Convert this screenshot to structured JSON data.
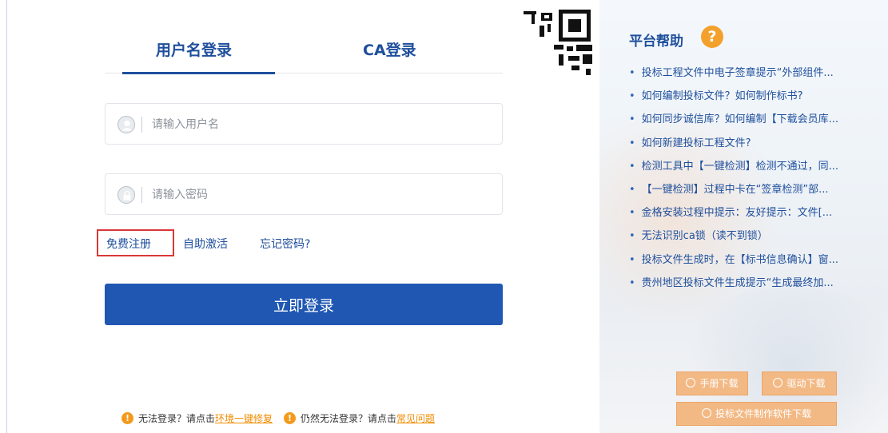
{
  "login": {
    "tabs": [
      {
        "label": "用户名登录",
        "active": true
      },
      {
        "label": "CA登录",
        "active": false
      }
    ],
    "username_placeholder": "请输入用户名",
    "password_placeholder": "请输入密码",
    "links": {
      "register": "免费注册",
      "activate": "自助激活",
      "forgot": "忘记密码?"
    },
    "submit_label": "立即登录",
    "bottom": {
      "warn_icon": "!",
      "text1": "无法登录？请点击",
      "link1": "环境一键修复",
      "text2": "仍然无法登录？请点击",
      "link2": "常见问题"
    }
  },
  "help": {
    "title": "平台帮助",
    "question_icon": "?",
    "items": [
      "投标工程文件中电子签章提示“外部组件...",
      "如何编制投标文件？如何制作标书?",
      "如何同步诚信库？如何编制【下载会员库...",
      "如何新建投标工程文件?",
      "检测工具中【一键检测】检测不通过，同...",
      "【一键检测】过程中卡在“签章检测”部...",
      "金格安装过程中提示：友好提示：文件[...",
      "无法识别ca锁（读不到锁）",
      "投标文件生成时，在【标书信息确认】窗...",
      "贵州地区投标文件生成提示“生成最终加..."
    ],
    "downloads": {
      "manual": "手册下载",
      "driver": "驱动下载",
      "software": "投标文件制作软件下载"
    }
  },
  "colors": {
    "brand": "#1f4f9c",
    "button": "#1f57b2",
    "warning": "#f39a1e",
    "highlight_box": "#d93838",
    "download_button": "#f3b985"
  },
  "icons": {
    "username": "user-circle-icon",
    "password": "lock-circle-icon",
    "qr": "qr-code-icon",
    "help": "question-mark-icon",
    "download": "download-circle-icon"
  }
}
